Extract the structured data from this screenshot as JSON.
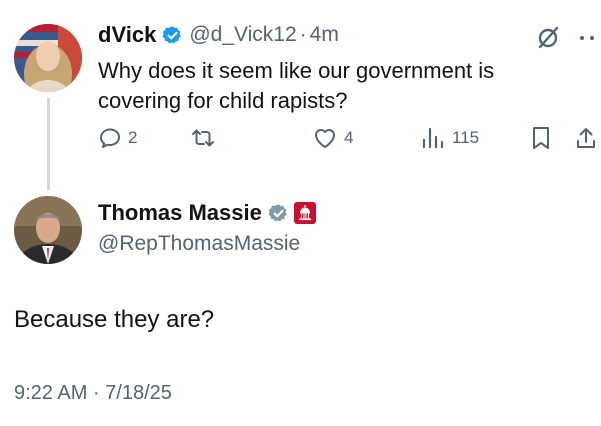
{
  "tweet1": {
    "name": "dVick",
    "handle": "@d_Vick12",
    "separator": "·",
    "time": "4m",
    "text": "Why does it seem like our government is covering for child rapists?",
    "actions": {
      "reply_count": "2",
      "like_count": "4",
      "views_count": "115"
    }
  },
  "tweet2": {
    "name": "Thomas Massie",
    "handle": "@RepThomasMassie",
    "text": "Because they are?",
    "timestamp": "9:22 AM · 7/18/25"
  },
  "icons": {
    "verified_blue": "verified-badge-icon",
    "verified_gray": "government-verified-icon",
    "affiliate": "capitol-affiliate-icon",
    "grok": "grok-icon",
    "more": "more-icon",
    "reply": "reply-icon",
    "retweet": "retweet-icon",
    "like": "heart-icon",
    "views": "views-icon",
    "bookmark": "bookmark-icon",
    "share": "share-icon"
  },
  "colors": {
    "text": "#0f1419",
    "secondary": "#536471",
    "verified_blue": "#1d9bf0",
    "verified_gray": "#829aab",
    "affiliate_red": "#c8102e",
    "thread_line": "#cfd9de"
  }
}
